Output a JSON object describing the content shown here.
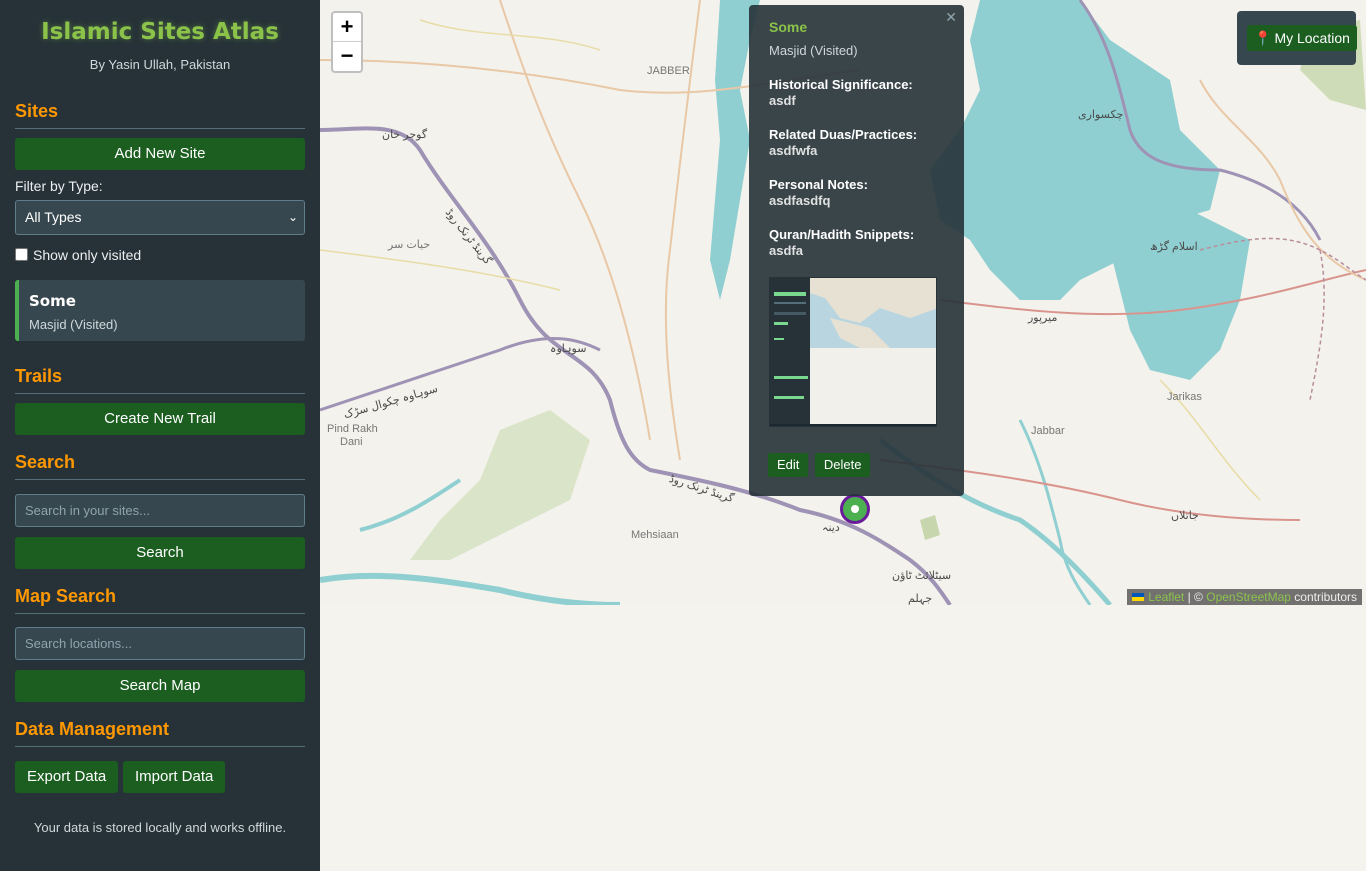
{
  "app": {
    "title": "Islamic Sites Atlas",
    "author": "By Yasin Ullah, Pakistan"
  },
  "sites": {
    "heading": "Sites",
    "add_button": "Add New Site",
    "filter_label": "Filter by Type:",
    "filter_value": "All Types",
    "visited_label": "Show only visited",
    "items": [
      {
        "name": "Some",
        "meta": "Masjid (Visited)"
      }
    ]
  },
  "trails": {
    "heading": "Trails",
    "create_button": "Create New Trail"
  },
  "search": {
    "heading": "Search",
    "placeholder": "Search in your sites...",
    "button": "Search"
  },
  "map_search": {
    "heading": "Map Search",
    "placeholder": "Search locations...",
    "button": "Search Map"
  },
  "data_management": {
    "heading": "Data Management",
    "export_button": "Export Data",
    "import_button": "Import Data",
    "note": "Your data is stored locally and works offline."
  },
  "map": {
    "zoom_in": "+",
    "zoom_out": "−",
    "my_location": "My Location",
    "attribution": {
      "leaflet": "Leaflet",
      "sep": "| ©",
      "osm": "OpenStreetMap",
      "suffix": "contributors"
    },
    "labels": {
      "jabber_top": "JABBER",
      "gujar_khan": "گوجر خان",
      "gt_road_1": "گرینڈ ٹرنک روڈ",
      "hayat_sar": "حیات سر",
      "sohawa": "سوہاوہ",
      "sohawa_chakwal": "سوہاوہ چکوال سڑک",
      "pind_rakh": "Pind Rakh",
      "dani": "Dani",
      "gt_road_2": "گرینڈ ٹرنک روڈ",
      "mehsiaan": "Mehsiaan",
      "dina": "دینہ",
      "sitelite": "سیٹلائٹ ٹاؤن",
      "jhelum": "جہلم",
      "chakswari": "چکسواری",
      "islamgarh": "اسلام گڑھ",
      "mirpur": "میرپور",
      "jarikas": "Jarikas",
      "jabbar": "Jabbar",
      "jalalpur": "جاتلاں"
    }
  },
  "popup": {
    "title": "Some",
    "meta": "Masjid (Visited)",
    "fields": [
      {
        "label": "Historical Significance:",
        "value": "asdf"
      },
      {
        "label": "Related Duas/Practices:",
        "value": "asdfwfa"
      },
      {
        "label": "Personal Notes:",
        "value": "asdfasdfq"
      },
      {
        "label": "Quran/Hadith Snippets:",
        "value": "asdfa"
      }
    ],
    "thumbnail_title": "Islamic Sites Atlas",
    "edit_button": "Edit",
    "delete_button": "Delete"
  },
  "colors": {
    "sidebar_bg": "#263238",
    "accent_green": "#1b5e20",
    "title_green": "#8bc34a",
    "heading_orange": "#ff9800",
    "water": "#8fcfd1"
  }
}
